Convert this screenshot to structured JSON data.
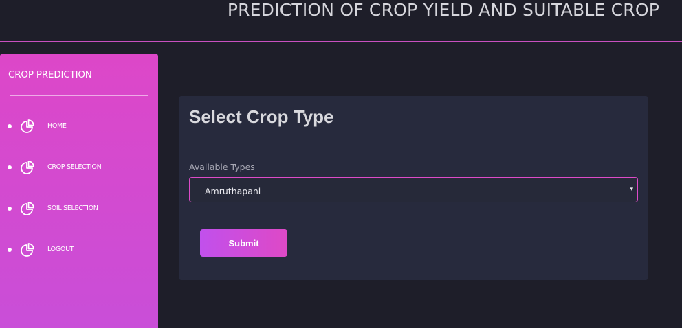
{
  "header": {
    "title": "PREDICTION OF CROP YIELD AND SUITABLE CROP"
  },
  "sidebar": {
    "brand": "CROP PREDICTION",
    "items": [
      {
        "label": "HOME",
        "icon": "pie-chart-icon"
      },
      {
        "label": "CROP SELECTION",
        "icon": "pie-chart-icon"
      },
      {
        "label": "SOIL SELECTION",
        "icon": "pie-chart-icon"
      },
      {
        "label": "LOGOUT",
        "icon": "pie-chart-icon"
      }
    ]
  },
  "main": {
    "title": "Select Crop Type",
    "field_label": "Available Types",
    "selected_type": "Amruthapani",
    "caret": "▾",
    "submit_label": "Submit"
  },
  "colors": {
    "accent": "#dd4bc8",
    "background": "#1e1e29",
    "card": "#272a3d"
  }
}
